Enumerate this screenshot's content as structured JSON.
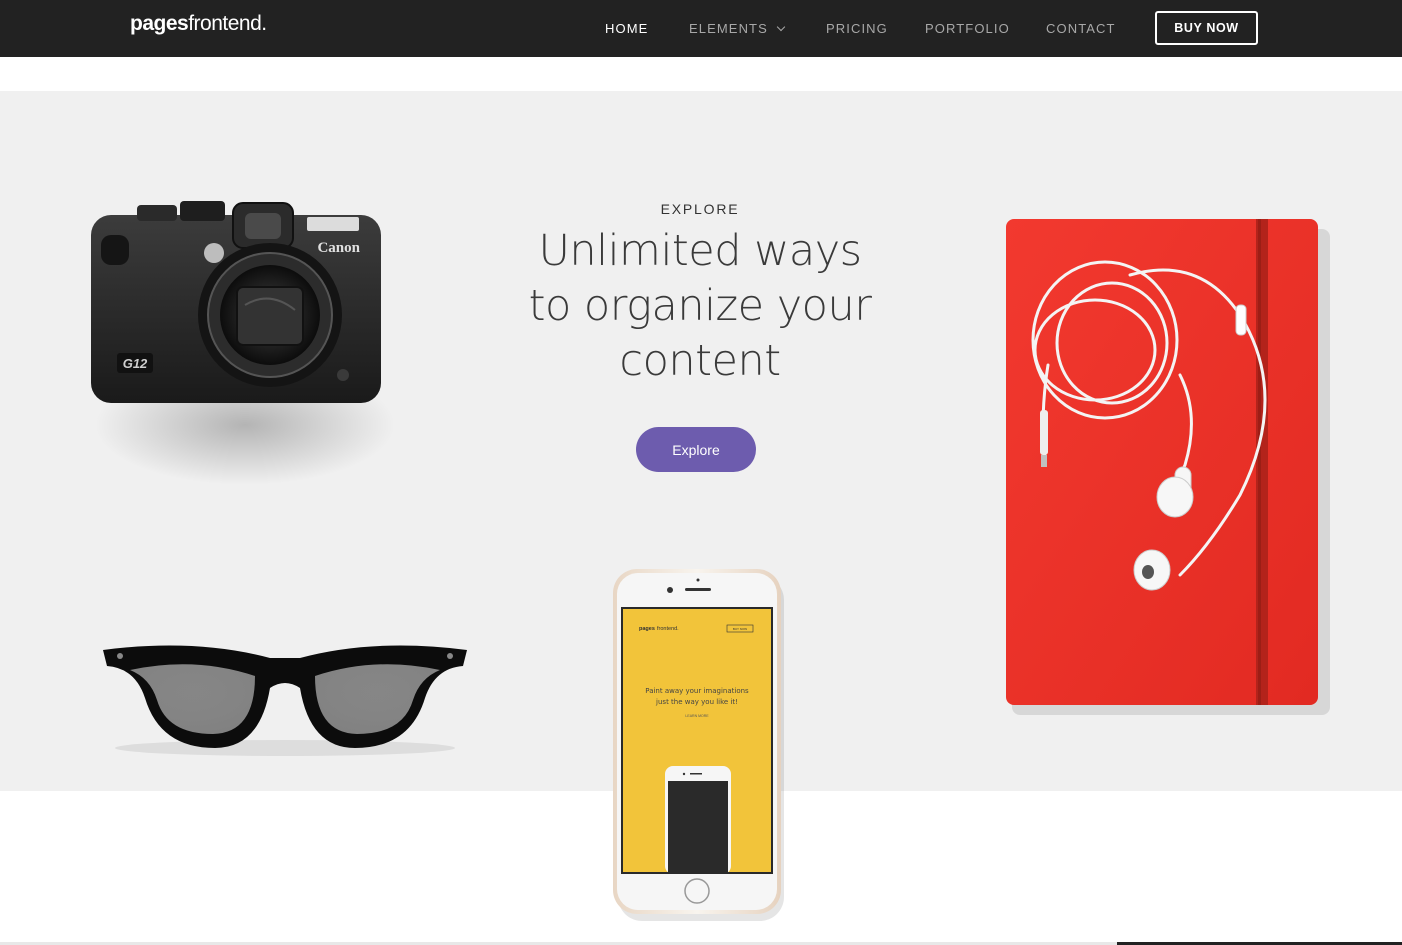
{
  "brand": {
    "logo_bold": "pages",
    "logo_light": "frontend."
  },
  "nav": {
    "items": [
      {
        "label": "HOME",
        "active": true
      },
      {
        "label": "ELEMENTS",
        "has_dropdown": true
      },
      {
        "label": "PRICING"
      },
      {
        "label": "PORTFOLIO"
      },
      {
        "label": "CONTACT"
      }
    ],
    "cta_label": "BUY NOW"
  },
  "hero": {
    "eyebrow": "EXPLORE",
    "headline_line1": "Unlimited ways",
    "headline_line2": "to organize your",
    "headline_line3": "content",
    "button_label": "Explore"
  },
  "props": {
    "camera_brand": "Canon",
    "camera_model": "G12",
    "phone_logo_bold": "pages",
    "phone_logo_light": "frontend.",
    "phone_cta": "BUY NOW",
    "phone_tagline1": "Paint away your imaginations",
    "phone_tagline2": "just the way you like it!",
    "phone_sub": "LEARN MORE"
  },
  "colors": {
    "navbar_bg": "#222222",
    "hero_bg": "#f0f0f0",
    "accent": "#6d5cae",
    "notebook_red": "#f0322a",
    "phone_screen": "#f2c43a"
  },
  "icons": [
    "chevron-down-icon"
  ]
}
